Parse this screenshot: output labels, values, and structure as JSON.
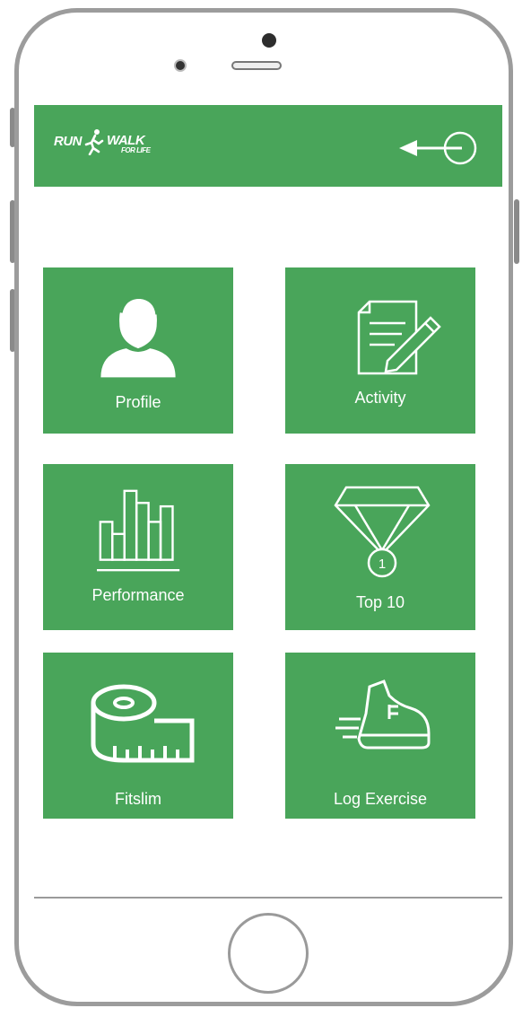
{
  "app": {
    "logo_run": "RUN",
    "logo_walk": "WALK",
    "logo_tagline": "FOR LIFE"
  },
  "tiles": [
    {
      "label": "Profile",
      "icon": "user-icon"
    },
    {
      "label": "Activity",
      "icon": "document-pencil-icon"
    },
    {
      "label": "Performance",
      "icon": "bar-chart-icon"
    },
    {
      "label": "Top 10",
      "icon": "medal-icon"
    },
    {
      "label": "Fitslim",
      "icon": "measuring-tape-icon"
    },
    {
      "label": "Log Exercise",
      "icon": "running-shoe-icon"
    }
  ],
  "colors": {
    "accent": "#49a55a",
    "frame": "#9c9c9c",
    "text_on_accent": "#ffffff"
  }
}
